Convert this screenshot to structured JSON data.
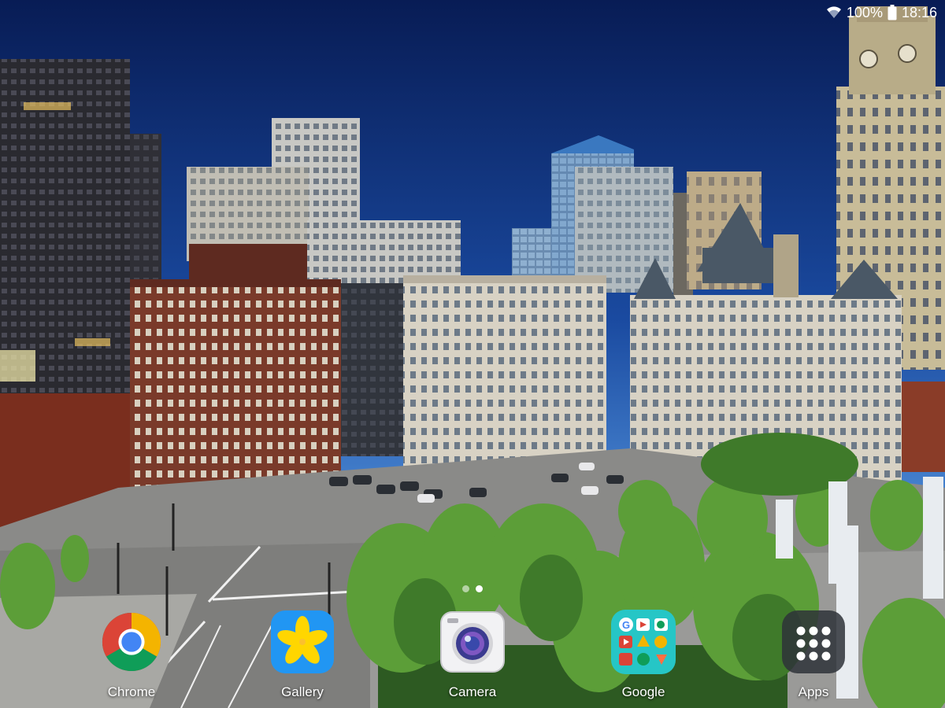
{
  "status_bar": {
    "wifi_icon": "wifi-icon",
    "battery_percent": "100%",
    "battery_icon": "battery-full-icon",
    "time": "18:16"
  },
  "home_screen": {
    "wallpaper": "Boston city skyline at dusk with clock tower and park",
    "page_indicator": {
      "pages": 2,
      "current": 2
    },
    "dock": [
      {
        "label": "Chrome",
        "icon": "chrome-icon"
      },
      {
        "label": "Gallery",
        "icon": "gallery-icon"
      },
      {
        "label": "Camera",
        "icon": "camera-icon"
      },
      {
        "label": "Google",
        "icon": "google-folder-icon"
      },
      {
        "label": "Apps",
        "icon": "apps-grid-icon"
      }
    ]
  },
  "colors": {
    "sky_top": "#0a2466",
    "sky_bottom": "#4a8fd8",
    "tree_green": "#5a9e3a",
    "chrome_red": "#db4437",
    "chrome_yellow": "#f4b400",
    "chrome_green": "#0f9d58",
    "chrome_blue": "#4285f4",
    "gallery_blue": "#2196f3",
    "gallery_yellow": "#ffd600",
    "google_folder_teal": "#26c6c6"
  }
}
